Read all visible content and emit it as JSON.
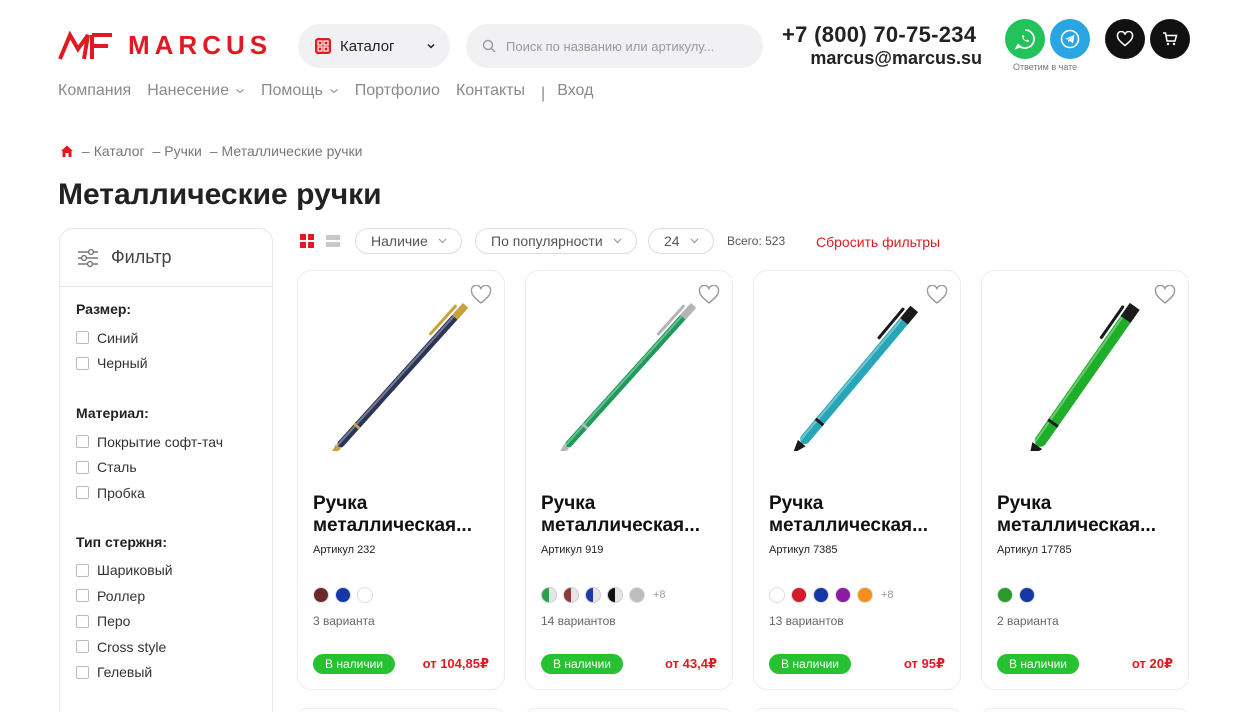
{
  "brand": {
    "name": "MARCUS",
    "color": "#e11a22"
  },
  "header": {
    "catalog_label": "Каталог",
    "search_placeholder": "Поиск по названию или артикулу...",
    "phone": "+7 (800) 70-75-234",
    "email": "marcus@marcus.su",
    "chat_note": "Ответим в чате",
    "icons": [
      "whatsapp-icon",
      "telegram-icon",
      "heart-icon",
      "cart-icon"
    ]
  },
  "nav": {
    "items": [
      "Компания",
      "Нанесение",
      "Помощь",
      "Портфолио",
      "Контакты"
    ],
    "separator": "|",
    "login": "Вход"
  },
  "breadcrumb": [
    "Каталог",
    "Ручки",
    "Металлические ручки"
  ],
  "page_title": "Металлические ручки",
  "filter": {
    "title": "Фильтр",
    "groups": [
      {
        "title": "Размер:",
        "options": [
          "Синий",
          "Черный"
        ]
      },
      {
        "title": "Материал:",
        "options": [
          "Покрытие софт-тач",
          "Сталь",
          "Пробка"
        ]
      },
      {
        "title": "Тип стержня:",
        "options": [
          "Шариковый",
          "Роллер",
          "Перо",
          "Cross style",
          "Гелевый"
        ]
      }
    ]
  },
  "toolbar": {
    "availability": "Наличие",
    "sort": "По популярности",
    "per_page": "24",
    "total_label": "Всего: 523",
    "reset": "Сбросить фильтры"
  },
  "products": [
    {
      "name": "Ручка металлическая...",
      "sku": "Артикул 232",
      "variants": "3 варианта",
      "availability": "В наличии",
      "price": "от 104,85₽",
      "pen_color": "#2b3557",
      "trim": "#c8a23c",
      "swatches": [
        "#6b2a2a",
        "#1537a8",
        "#ffffff"
      ],
      "more": ""
    },
    {
      "name": "Ручка металлическая...",
      "sku": "Артикул 919",
      "variants": "14 вариантов",
      "availability": "В наличии",
      "price": "от 43,4₽",
      "pen_color": "#1f9a5a",
      "trim": "#b5b5b5",
      "swatches": [
        "half:#2aa24a",
        "half:#8a3a3a",
        "half:#1d3aa8",
        "half:#111111",
        "#bdbdbd"
      ],
      "more": "+8"
    },
    {
      "name": "Ручка металлическая...",
      "sku": "Артикул 7385",
      "variants": "13 вариантов",
      "availability": "В наличии",
      "price": "от 95₽",
      "pen_color": "#28a6b8",
      "trim": "#1a1a1a",
      "swatches": [
        "#ffffff",
        "#d21c2c",
        "#1537a8",
        "#8a1aa0",
        "#f5901a"
      ],
      "more": "+8"
    },
    {
      "name": "Ручка металлическая...",
      "sku": "Артикул 17785",
      "variants": "2 варианта",
      "availability": "В наличии",
      "price": "от 20₽",
      "pen_color": "#1fae2a",
      "trim": "#1a1a1a",
      "swatches": [
        "#2a9a2a",
        "#1537a8"
      ],
      "more": ""
    }
  ]
}
